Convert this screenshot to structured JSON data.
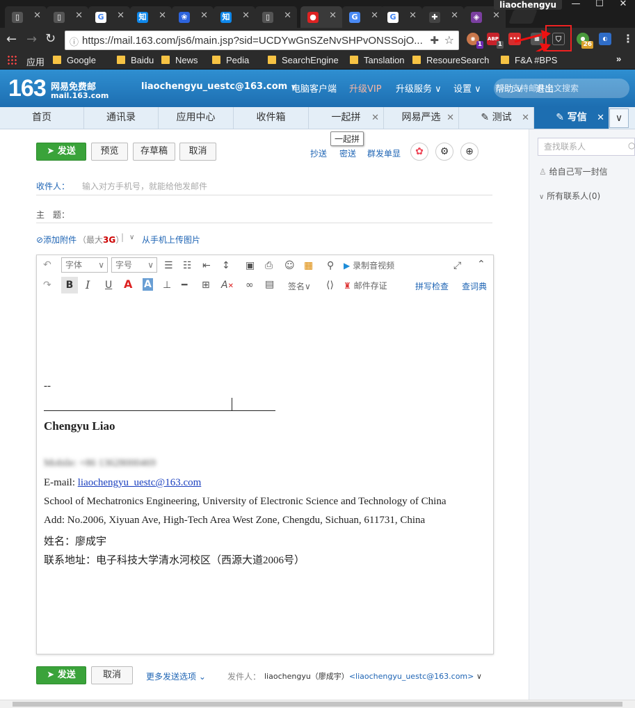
{
  "browser": {
    "profile": "liaochengyu",
    "url": "https://mail.163.com/js6/main.jsp?sid=UCDYwGnSZeNvSHPvONSSojO...",
    "tabs": [
      {
        "icon": "file-icon",
        "color": "#555",
        "glyph": "▯"
      },
      {
        "icon": "file-icon",
        "color": "#555",
        "glyph": "▯"
      },
      {
        "icon": "google-icon",
        "color": "#fff",
        "glyph": "G"
      },
      {
        "icon": "zhihu-icon",
        "color": "#0f88eb",
        "glyph": "知"
      },
      {
        "icon": "baidu-icon",
        "color": "#2d64dd",
        "glyph": "❀"
      },
      {
        "icon": "zhihu-icon",
        "color": "#0f88eb",
        "glyph": "知"
      },
      {
        "icon": "file-icon",
        "color": "#555",
        "glyph": "▯"
      },
      {
        "icon": "mail163-icon",
        "color": "#d22",
        "glyph": "●"
      },
      {
        "icon": "translate-icon",
        "color": "#4a8af4",
        "glyph": "G"
      },
      {
        "icon": "google-icon",
        "color": "#fff",
        "glyph": "G"
      },
      {
        "icon": "puzzle-icon",
        "color": "#444",
        "glyph": "✚"
      },
      {
        "icon": "mask-icon",
        "color": "#7b3fa0",
        "glyph": "◈"
      }
    ],
    "bookmarks": {
      "apps": "应用",
      "items": [
        "Google",
        "Baidu",
        "News",
        "Pedia",
        "SearchEngine",
        "Tanslation",
        "ResoureSearch",
        "F&A #BPS"
      ]
    },
    "ext_badges": {
      "a": "1",
      "b": "ABP",
      "c": "1",
      "d": "26"
    }
  },
  "mail": {
    "logo_num": "163",
    "logo_cn": "网易免费邮",
    "logo_domain": "mail.163.com",
    "account": "liaochengyu_uestc@163.com",
    "header_links": [
      "电脑客户端",
      "升级VIP",
      "升级服务",
      "设置",
      "帮助",
      "退出"
    ],
    "search_placeholder": "支持邮件全文搜索",
    "tabs": [
      "首页",
      "通讯录",
      "应用中心",
      "收件箱",
      "一起拼",
      "网易严选",
      "测试",
      "写信"
    ],
    "tooltip": "一起拼"
  },
  "compose": {
    "send": "发送",
    "preview": "预览",
    "draft": "存草稿",
    "cancel": "取消",
    "cc": "抄送",
    "bcc": "密送",
    "single": "群发单显",
    "to_label": "收件人：",
    "to_placeholder": "输入对方手机号，就能给他发邮件",
    "subject_label": "主　题：",
    "attach": "添加附件",
    "attach_max": "（最大",
    "attach_size": "3G",
    "attach_close": "）",
    "upload_phone": "从手机上传图片",
    "font": "字体",
    "fontsize": "字号",
    "record": "录制音视频",
    "signature": "签名",
    "store": "邮件存证",
    "spell": "拼写检查",
    "dict": "查词典",
    "more_options": "更多发送选项",
    "from_label": "发件人：",
    "from_name": "liaochengyu（廖成宇）",
    "from_addr": "<liaochengyu_uestc@163.com>"
  },
  "signature": {
    "dash": "--",
    "name": "Chengyu Liao",
    "mobile": "Mobile: +86 13628000469",
    "email_label": "E-mail: ",
    "email": "liaochengyu_uestc@163.com",
    "school": "School of Mechatronics Engineering, University of Electronic Science and Technology of China",
    "add": "Add: No.2006, Xiyuan Ave, High-Tech Area West Zone, Chengdu, Sichuan, 611731, China",
    "cn_name": "姓名：廖成宇",
    "cn_addr": "联系地址：电子科技大学清水河校区（西源大道2006号）"
  },
  "contacts": {
    "search": "查找联系人",
    "self": "给自己写一封信",
    "all": "所有联系人(0)"
  }
}
